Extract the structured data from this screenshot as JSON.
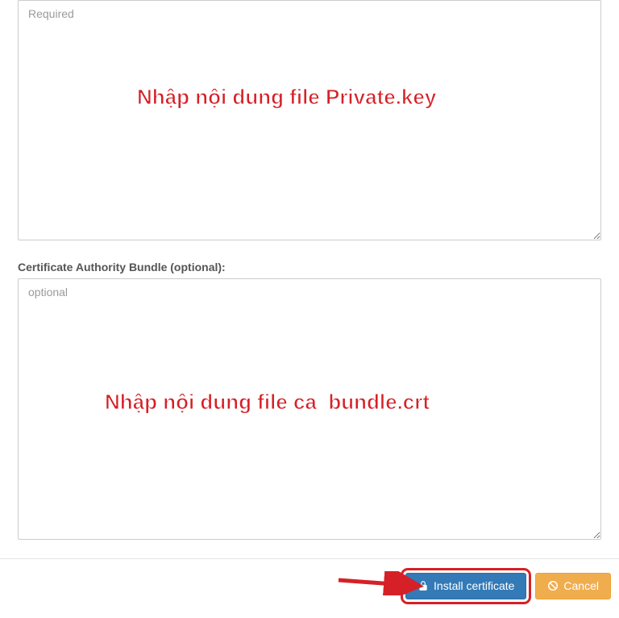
{
  "fields": {
    "private_key": {
      "placeholder": "Required",
      "value": "",
      "annotation": "Nhập nội dung file Private.key"
    },
    "ca_bundle": {
      "label": "Certificate Authority Bundle (optional):",
      "placeholder": "optional",
      "value": "",
      "annotation": "Nhập nội dung file ca_bundle.crt"
    }
  },
  "buttons": {
    "install": "Install certificate",
    "cancel": "Cancel"
  }
}
